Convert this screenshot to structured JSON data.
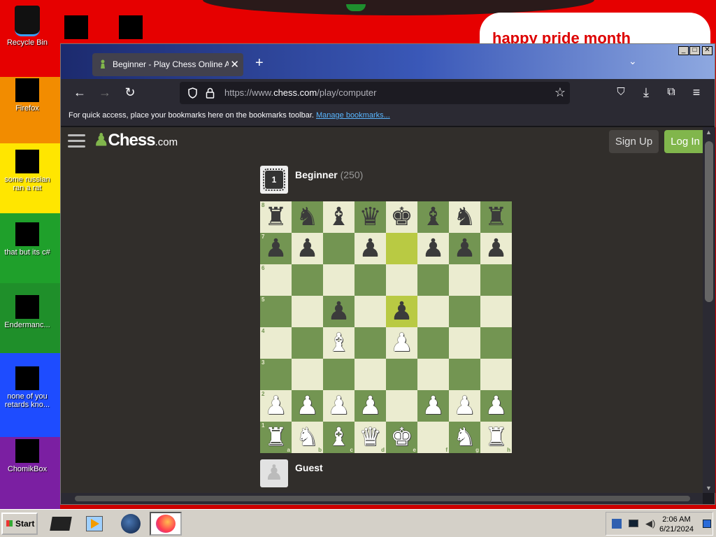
{
  "desktop": {
    "banner_text": "happy pride month",
    "icons": [
      {
        "label": "Recycle Bin"
      },
      {
        "label": "Firefox"
      },
      {
        "label": "some russian ran a rat"
      },
      {
        "label": "that but its c#"
      },
      {
        "label": "Endermanc..."
      },
      {
        "label": "none of you retards kno..."
      },
      {
        "label": "ChomikBox"
      }
    ]
  },
  "browser": {
    "tab_title": "Beginner - Play Chess Online Against",
    "url_prefix": "https://www.",
    "url_domain": "chess.com",
    "url_path": "/play/computer",
    "bookmarks_text": "For quick access, place your bookmarks here on the bookmarks toolbar.",
    "bookmarks_link": "Manage bookmarks..."
  },
  "site": {
    "logo": "Chess",
    "logo_suffix": ".com",
    "signup_label": "Sign Up",
    "login_label": "Log In",
    "opponent_badge": "1",
    "opponent_name": "Beginner",
    "opponent_rating": "(250)",
    "player_name": "Guest"
  },
  "board": {
    "ranks": [
      "8",
      "7",
      "6",
      "5",
      "4",
      "3",
      "2",
      "1"
    ],
    "files": [
      "a",
      "b",
      "c",
      "d",
      "e",
      "f",
      "g",
      "h"
    ],
    "highlight": [
      "e7",
      "e5"
    ],
    "position": {
      "a8": "br",
      "b8": "bn",
      "c8": "bb",
      "d8": "bq",
      "e8": "bk",
      "f8": "bb",
      "g8": "bn",
      "h8": "br",
      "a7": "bp",
      "b7": "bp",
      "d7": "bp",
      "f7": "bp",
      "g7": "bp",
      "h7": "bp",
      "c5": "bp",
      "e5": "bp",
      "c4": "wb",
      "e4": "wp",
      "a2": "wp",
      "b2": "wp",
      "c2": "wp",
      "d2": "wp",
      "f2": "wp",
      "g2": "wp",
      "h2": "wp",
      "a1": "wr",
      "b1": "wn",
      "c1": "wb",
      "d1": "wq",
      "e1": "wk",
      "g1": "wn",
      "h1": "wr"
    },
    "colors": {
      "light": "#ebecd0",
      "dark": "#739552",
      "highlight_light": "#f5f682",
      "highlight_dark": "#b9ca43"
    }
  },
  "taskbar": {
    "start_label": "Start",
    "time": "2:06 AM",
    "date": "6/21/2024"
  }
}
